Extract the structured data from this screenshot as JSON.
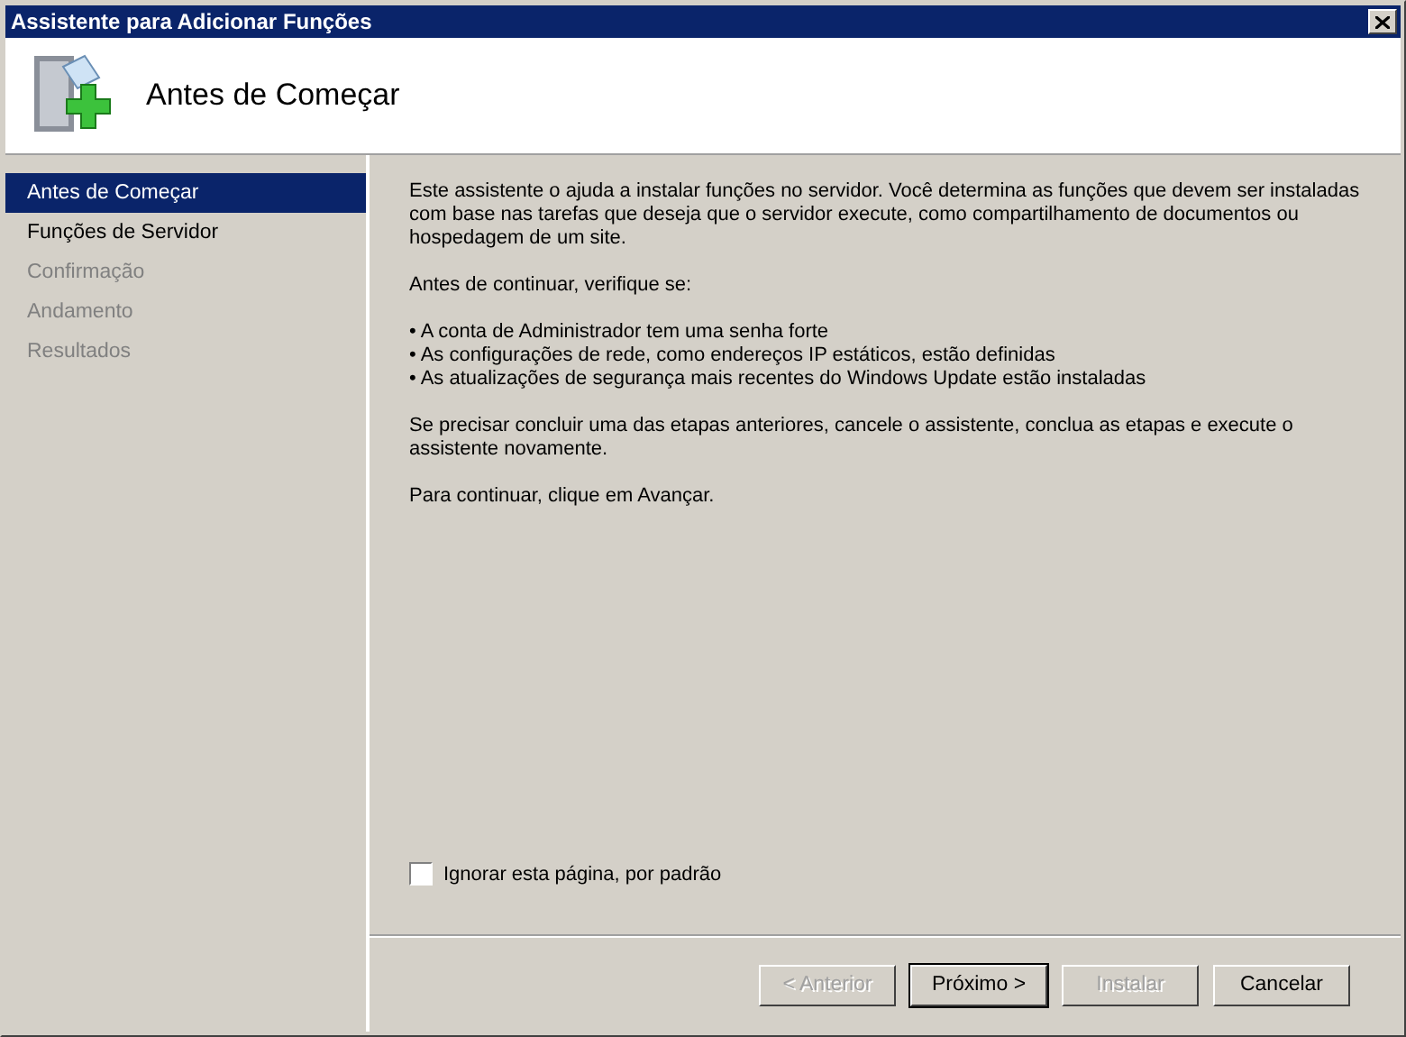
{
  "window": {
    "title": "Assistente para Adicionar Funções"
  },
  "header": {
    "title": "Antes de Começar"
  },
  "sidebar": {
    "items": [
      {
        "label": "Antes de Começar",
        "selected": true,
        "disabled": false
      },
      {
        "label": "Funções de Servidor",
        "selected": false,
        "disabled": false
      },
      {
        "label": "Confirmação",
        "selected": false,
        "disabled": true
      },
      {
        "label": "Andamento",
        "selected": false,
        "disabled": true
      },
      {
        "label": "Resultados",
        "selected": false,
        "disabled": true
      }
    ]
  },
  "content": {
    "paragraphs": [
      {
        "kind": "text",
        "text": "Este assistente o ajuda a instalar funções no servidor. Você determina as funções que devem ser instaladas com base nas tarefas que deseja que o servidor execute, como compartilhamento de documentos ou hospedagem de um site."
      },
      {
        "kind": "text",
        "text": "Antes de continuar, verifique se:"
      },
      {
        "kind": "bullets",
        "items": [
          "A conta de Administrador tem uma senha forte",
          "As configurações de rede, como endereços IP estáticos, estão definidas",
          "As atualizações de segurança mais recentes do Windows Update estão instaladas"
        ]
      },
      {
        "kind": "text",
        "text": "Se precisar concluir uma das etapas anteriores, cancele o assistente, conclua as etapas e execute o assistente novamente."
      },
      {
        "kind": "text",
        "text": "Para continuar, clique em Avançar."
      }
    ],
    "bullet": "•",
    "skip_checkbox": {
      "label": "Ignorar esta página, por padrão",
      "checked": false
    }
  },
  "buttons": [
    {
      "label": "< Anterior",
      "disabled": true,
      "default": false
    },
    {
      "label": "Próximo >",
      "disabled": false,
      "default": true
    },
    {
      "label": "Instalar",
      "disabled": true,
      "default": false
    },
    {
      "label": "Cancelar",
      "disabled": false,
      "default": false
    }
  ]
}
